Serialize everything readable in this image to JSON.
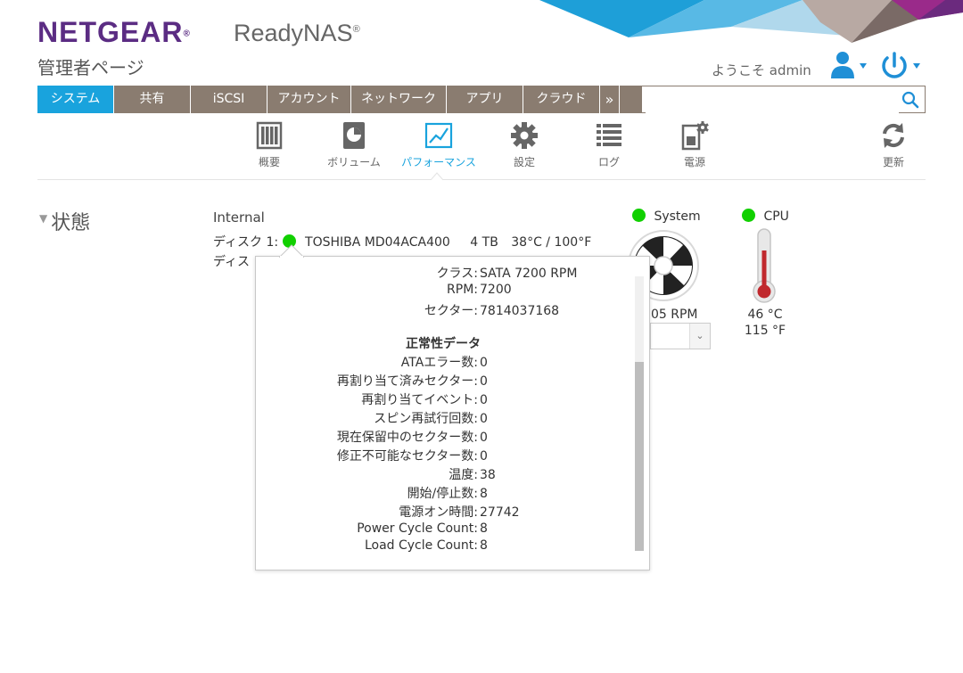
{
  "brand": {
    "logo": "NETGEAR",
    "logo_mark": "®",
    "product": "ReadyNAS",
    "product_mark": "®"
  },
  "page": {
    "title": "管理者ページ"
  },
  "header": {
    "welcome": "ようこそ admin"
  },
  "nav": {
    "tabs": [
      {
        "label": "システム"
      },
      {
        "label": "共有"
      },
      {
        "label": "iSCSI"
      },
      {
        "label": "アカウント"
      },
      {
        "label": "ネットワーク"
      },
      {
        "label": "アプリ"
      },
      {
        "label": "クラウド"
      }
    ],
    "more": "»",
    "search_value": ""
  },
  "subnav": {
    "items": [
      {
        "label": "概要"
      },
      {
        "label": "ボリューム"
      },
      {
        "label": "パフォーマンス"
      },
      {
        "label": "設定"
      },
      {
        "label": "ログ"
      },
      {
        "label": "電源"
      },
      {
        "label": "更新"
      }
    ]
  },
  "status": {
    "title": "状態",
    "group": "Internal",
    "disk1": {
      "label": "ディスク 1:",
      "model": "TOSHIBA MD04ACA400",
      "size": "4 TB",
      "temp": "38°C / 100°F"
    },
    "disk2_partial": {
      "label": "ディス"
    },
    "system": {
      "label": "System",
      "rpm": "05 RPM"
    },
    "cpu": {
      "label": "CPU",
      "temp_c": "46 °C",
      "temp_f": "115 °F"
    }
  },
  "popup": {
    "cut_row": {
      "key": "クラス:",
      "value": "SATA 7200 RPM"
    },
    "rows_top": [
      {
        "key": "RPM:",
        "value": "7200"
      },
      {
        "key": "セクター:",
        "value": "7814037168"
      }
    ],
    "health_heading": "正常性データ",
    "rows_health": [
      {
        "key": "ATAエラー数:",
        "value": "0"
      },
      {
        "key": "再割り当て済みセクター:",
        "value": "0"
      },
      {
        "key": "再割り当てイベント:",
        "value": "0"
      },
      {
        "key": "スピン再試行回数:",
        "value": "0"
      },
      {
        "key": "現在保留中のセクター数:",
        "value": "0"
      },
      {
        "key": "修正不可能なセクター数:",
        "value": "0"
      },
      {
        "key": "温度:",
        "value": "38"
      },
      {
        "key": "開始/停止数:",
        "value": "8"
      },
      {
        "key": "電源オン時間:",
        "value": "27742"
      },
      {
        "key": "Power Cycle Count:",
        "value": "8"
      },
      {
        "key": "Load Cycle Count:",
        "value": "8"
      }
    ]
  },
  "colors": {
    "brand_purple": "#5b2c83",
    "accent_blue": "#19a3dd",
    "tab_gray": "#8a7c70",
    "status_green": "#11d000"
  }
}
